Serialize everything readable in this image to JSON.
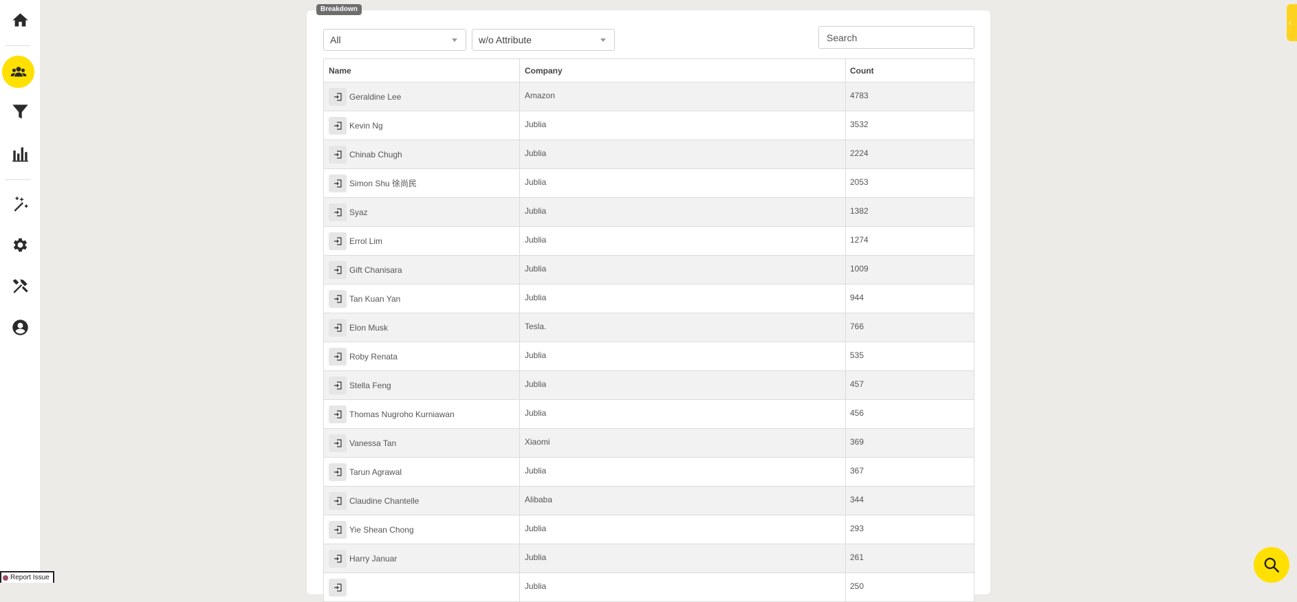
{
  "sidebar": {
    "icons": [
      "home-icon",
      "users-icon",
      "filter-icon",
      "bar-chart-icon",
      "magic-wand-icon",
      "gear-icon",
      "tools-icon",
      "user-circle-icon"
    ],
    "active": "users-icon",
    "accent": "#ffe000"
  },
  "report_issue": {
    "label": "Report Issue"
  },
  "card": {
    "tag": "Breakdown",
    "filter_all": "All",
    "filter_attribute": "w/o Attribute",
    "search_placeholder": "Search"
  },
  "table": {
    "headers": {
      "name": "Name",
      "company": "Company",
      "count": "Count"
    },
    "rows": [
      {
        "name": "Geraldine Lee",
        "company": "Amazon",
        "count": "4783"
      },
      {
        "name": "Kevin Ng",
        "company": "Jublia",
        "count": "3532"
      },
      {
        "name": "Chinab Chugh",
        "company": "Jublia",
        "count": "2224"
      },
      {
        "name": "Simon Shu 徐尚民",
        "company": "Jublia",
        "count": "2053"
      },
      {
        "name": "Syaz",
        "company": "Jublia",
        "count": "1382"
      },
      {
        "name": "Errol Lim",
        "company": "Jublia",
        "count": "1274"
      },
      {
        "name": "Gift Chanisara",
        "company": "Jublia",
        "count": "1009"
      },
      {
        "name": "Tan Kuan Yan",
        "company": "Jublia",
        "count": "944"
      },
      {
        "name": "Elon Musk",
        "company": "Tesla.",
        "count": "766"
      },
      {
        "name": "Roby Renata",
        "company": "Jublia",
        "count": "535"
      },
      {
        "name": "Stella Feng",
        "company": "Jublia",
        "count": "457"
      },
      {
        "name": "Thomas Nugroho Kurniawan",
        "company": "Jublia",
        "count": "456"
      },
      {
        "name": "Vanessa Tan",
        "company": "Xiaomi",
        "count": "369"
      },
      {
        "name": "Tarun Agrawal",
        "company": "Jublia",
        "count": "367"
      },
      {
        "name": "Claudine Chantelle",
        "company": "Alibaba",
        "count": "344"
      },
      {
        "name": "Yie Shean Chong",
        "company": "Jublia",
        "count": "293"
      },
      {
        "name": "Harry Januar",
        "company": "Jublia",
        "count": "261"
      },
      {
        "name": "",
        "company": "Jublia",
        "count": "250"
      }
    ]
  },
  "fab": {
    "icon": "search-icon"
  }
}
